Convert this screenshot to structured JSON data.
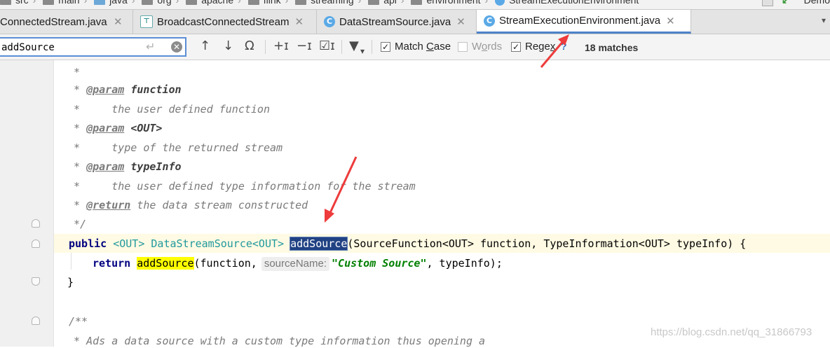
{
  "breadcrumb": {
    "items": [
      "src",
      "main",
      "java",
      "org",
      "apache",
      "flink",
      "streaming",
      "api",
      "environment",
      "StreamExecutionEnvironment"
    ],
    "right_label": "Demo"
  },
  "tabs": [
    {
      "label": "ConnectedStream.java",
      "icon": "class-icon",
      "active": false
    },
    {
      "label": "BroadcastConnectedStream",
      "icon": "interface-icon",
      "active": false
    },
    {
      "label": "DataStreamSource.java",
      "icon": "class-icon",
      "active": false
    },
    {
      "label": "StreamExecutionEnvironment.java",
      "icon": "class-icon",
      "active": true
    }
  ],
  "find": {
    "query": "addSource",
    "options": {
      "match_case": {
        "label_pre": "Match ",
        "label_ul": "C",
        "label_post": "ase",
        "checked": true
      },
      "words": {
        "label_pre": "W",
        "label_ul": "o",
        "label_post": "rds",
        "checked": false
      },
      "regex": {
        "label_pre": "Rege",
        "label_ul": "x",
        "label_post": "",
        "checked": true
      }
    },
    "help": "?",
    "match_count": "18 matches"
  },
  "code": {
    "l1": " *",
    "l2_star": " * ",
    "tag_param": "@param",
    "tag_return": "@return",
    "p_function": "function",
    "l3_text": " *     the user defined function",
    "p_out": "<OUT>",
    "l5_text": " *     type of the returned stream",
    "p_typeinfo": "typeInfo",
    "l7_text": " *     the user defined type information for the stream",
    "l8_desc": " the data stream constructed",
    "l9": " */",
    "kw_public": "public",
    "decl_a": " <OUT> DataStreamSource<OUT> ",
    "method_name": "addSource",
    "decl_b": "(SourceFunction<OUT> function, TypeInformation<OUT> typeInfo) {",
    "kw_return": "return",
    "call_name": "addSource",
    "call_a": "(function,",
    "param_hint": "sourceName:",
    "str_custom": "\"Custom Source\"",
    "call_b": ", typeInfo);",
    "close_brace": "}",
    "javadoc_open": "/**",
    "last_line": " * Ads a data source with a custom type information thus opening a"
  },
  "watermark": "https://blog.csdn.net/qq_31866793",
  "colors": {
    "accent": "#4c83c7",
    "find_highlight": "#ffff00",
    "selection": "#214283",
    "arrow": "#ee3b3b"
  }
}
